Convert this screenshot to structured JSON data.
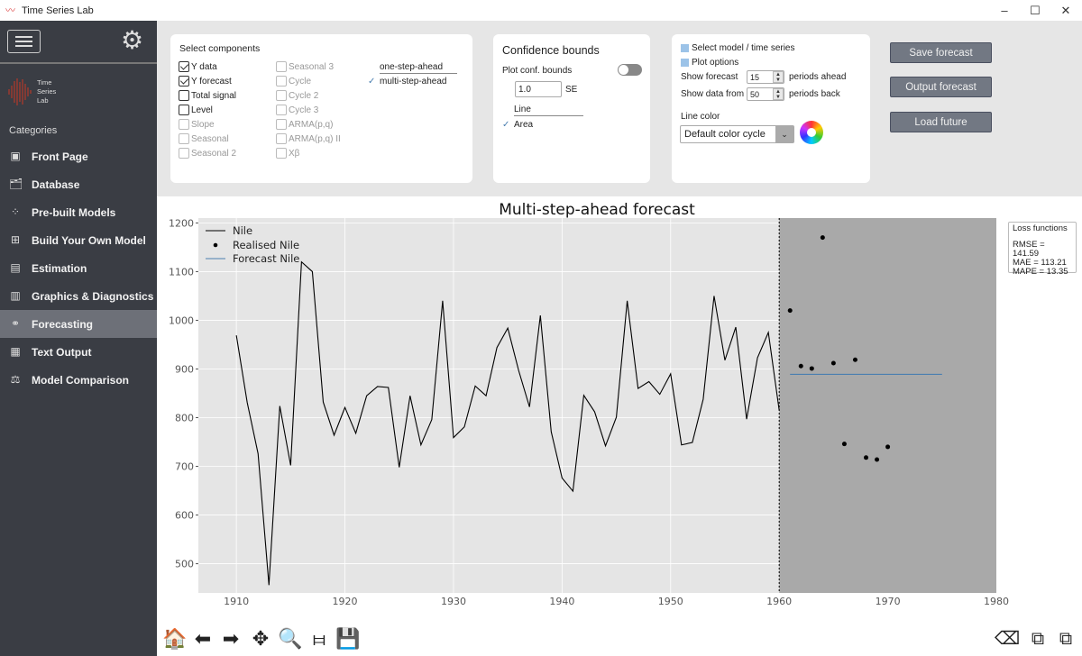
{
  "window": {
    "title": "Time Series Lab",
    "minimize": "–",
    "maximize": "☐",
    "close": "✕"
  },
  "sidebar": {
    "brand_lines": [
      "Time",
      "Series",
      "Lab"
    ],
    "categories_label": "Categories",
    "active": "Forecasting",
    "items": [
      {
        "label": "Front Page",
        "icon": "front-page-icon",
        "glyph": "▣"
      },
      {
        "label": "Database",
        "icon": "database-icon",
        "glyph": "🗂"
      },
      {
        "label": "Pre-built Models",
        "icon": "grid-dots-icon",
        "glyph": "⁘"
      },
      {
        "label": "Build Your Own Model",
        "icon": "build-model-icon",
        "glyph": "⊞"
      },
      {
        "label": "Estimation",
        "icon": "cpu-icon",
        "glyph": "▤"
      },
      {
        "label": "Graphics & Diagnostics",
        "icon": "bar-chart-icon",
        "glyph": "▥"
      },
      {
        "label": "Forecasting",
        "icon": "binoculars-icon",
        "glyph": "⚭"
      },
      {
        "label": "Text Output",
        "icon": "text-output-icon",
        "glyph": "▦"
      },
      {
        "label": "Model Comparison",
        "icon": "model-comparison-icon",
        "glyph": "⚖"
      }
    ]
  },
  "components": {
    "title": "Select components",
    "col1": [
      {
        "label": "Y data",
        "checked": true,
        "enabled": true
      },
      {
        "label": "Y forecast",
        "checked": true,
        "enabled": true
      },
      {
        "label": "Total signal",
        "checked": false,
        "enabled": true
      },
      {
        "label": "Level",
        "checked": false,
        "enabled": true
      },
      {
        "label": "Slope",
        "checked": false,
        "enabled": false
      },
      {
        "label": "Seasonal",
        "checked": false,
        "enabled": false
      },
      {
        "label": "Seasonal 2",
        "checked": false,
        "enabled": false
      }
    ],
    "col2": [
      {
        "label": "Seasonal 3",
        "checked": false,
        "enabled": false
      },
      {
        "label": "Cycle",
        "checked": false,
        "enabled": false
      },
      {
        "label": "Cycle 2",
        "checked": false,
        "enabled": false
      },
      {
        "label": "Cycle 3",
        "checked": false,
        "enabled": false
      },
      {
        "label": "ARMA(p,q)",
        "checked": false,
        "enabled": false
      },
      {
        "label": "ARMA(p,q) II",
        "checked": false,
        "enabled": false
      },
      {
        "label": "Xβ",
        "checked": false,
        "enabled": false
      }
    ],
    "modes": [
      {
        "label": "one-step-ahead",
        "selected": false
      },
      {
        "label": "multi-step-ahead",
        "selected": true
      }
    ]
  },
  "confidence": {
    "title": "Confidence bounds",
    "plot_label": "Plot conf. bounds",
    "toggle_on": false,
    "se_value": "1.0",
    "se_label": "SE",
    "styles": [
      {
        "label": "Line",
        "selected": false
      },
      {
        "label": "Area",
        "selected": true
      }
    ],
    "check": "✓"
  },
  "options": {
    "select_model": "Select model / time series",
    "plot_options": "Plot options",
    "show_forecast_label": "Show forecast",
    "show_forecast_value": "15",
    "periods_ahead": "periods ahead",
    "show_data_label": "Show data from",
    "show_data_value": "50",
    "periods_back": "periods back",
    "line_color_label": "Line color",
    "line_color_value": "Default color cycle"
  },
  "buttons": {
    "save": "Save forecast",
    "output": "Output forecast",
    "load": "Load future"
  },
  "losses": {
    "title": "Loss functions",
    "rmse": "RMSE = 141.59",
    "mae": "MAE = 113.21",
    "mape": "MAPE = 13.35"
  },
  "chart_data": {
    "type": "line",
    "title": "Multi-step-ahead forecast",
    "xlabel": "",
    "ylabel": "",
    "xlim": [
      1906.5,
      1980
    ],
    "ylim": [
      440,
      1210
    ],
    "xticks": [
      1910,
      1920,
      1930,
      1940,
      1950,
      1960,
      1970,
      1980
    ],
    "yticks": [
      500,
      600,
      700,
      800,
      900,
      1000,
      1100,
      1200
    ],
    "grid": true,
    "legend_position": "top-left",
    "forecast_origin": 1960,
    "series": [
      {
        "name": "Nile",
        "style": "line",
        "color": "#000000",
        "x": [
          1910,
          1911,
          1912,
          1913,
          1914,
          1915,
          1916,
          1917,
          1918,
          1919,
          1920,
          1921,
          1922,
          1923,
          1924,
          1925,
          1926,
          1927,
          1928,
          1929,
          1930,
          1931,
          1932,
          1933,
          1934,
          1935,
          1936,
          1937,
          1938,
          1939,
          1940,
          1941,
          1942,
          1943,
          1944,
          1945,
          1946,
          1947,
          1948,
          1949,
          1950,
          1951,
          1952,
          1953,
          1954,
          1955,
          1956,
          1957,
          1958,
          1959,
          1960
        ],
        "values": [
          969,
          831,
          726,
          456,
          824,
          702,
          1120,
          1100,
          832,
          764,
          821,
          768,
          845,
          864,
          862,
          698,
          845,
          744,
          796,
          1040,
          759,
          781,
          865,
          845,
          944,
          984,
          897,
          822,
          1010,
          771,
          676,
          649,
          846,
          812,
          742,
          801,
          1040,
          860,
          874,
          848,
          890,
          744,
          749,
          838,
          1050,
          918,
          986,
          797,
          923,
          975,
          815
        ]
      },
      {
        "name": "Realised Nile",
        "style": "points",
        "color": "#000000",
        "x": [
          1961,
          1962,
          1963,
          1964,
          1965,
          1966,
          1967,
          1968,
          1969,
          1970
        ],
        "values": [
          1020,
          906,
          901,
          1170,
          912,
          746,
          919,
          718,
          714,
          740
        ]
      },
      {
        "name": "Forecast Nile",
        "style": "line",
        "color": "#4a7fb0",
        "x": [
          1961,
          1975
        ],
        "values": [
          889,
          889
        ]
      }
    ]
  },
  "toolbar": [
    {
      "name": "home-icon",
      "glyph": "🏠"
    },
    {
      "name": "back-arrow-icon",
      "glyph": "⬅"
    },
    {
      "name": "forward-arrow-icon",
      "glyph": "➡"
    },
    {
      "name": "pan-icon",
      "glyph": "✥"
    },
    {
      "name": "zoom-icon",
      "glyph": "🔍"
    },
    {
      "name": "configure-subplots-icon",
      "glyph": "⧦"
    },
    {
      "name": "save-figure-icon",
      "glyph": "💾"
    }
  ]
}
